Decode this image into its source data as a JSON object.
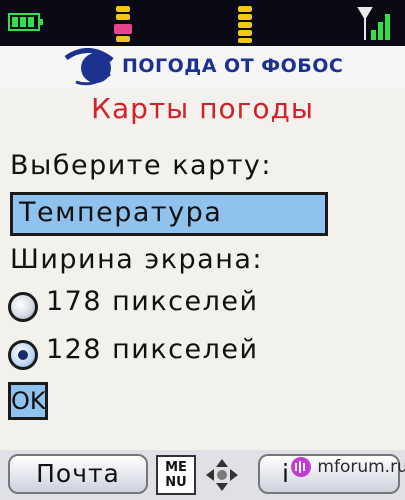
{
  "header": {
    "brand": "ПОГОДА ОТ ФОБОС"
  },
  "title": "Карты погоды",
  "map_select": {
    "label": "Выберите карту:",
    "value": "Температура"
  },
  "screen_width": {
    "label": "Ширина экрана:",
    "options": [
      {
        "label": "178 пикселей",
        "checked": false
      },
      {
        "label": "128 пикселей",
        "checked": true
      }
    ]
  },
  "ok_label": "OK",
  "softkeys": {
    "left": "Почта",
    "menu_line1": "ME",
    "menu_line2": "NU",
    "right": "i"
  },
  "watermark": "mforum.ru",
  "colors": {
    "title": "#d4202a",
    "brand": "#1d3290",
    "field_bg": "#8fc2ec",
    "status_bar_bg": "#0a0a14"
  },
  "icons": {
    "battery": "battery-icon",
    "status": [
      "sms-stack-icon",
      "message-stack-icon"
    ],
    "signal": "signal-strength-icon",
    "logo": "globe-logo-icon",
    "nav": "navigation-joystick-icon"
  }
}
